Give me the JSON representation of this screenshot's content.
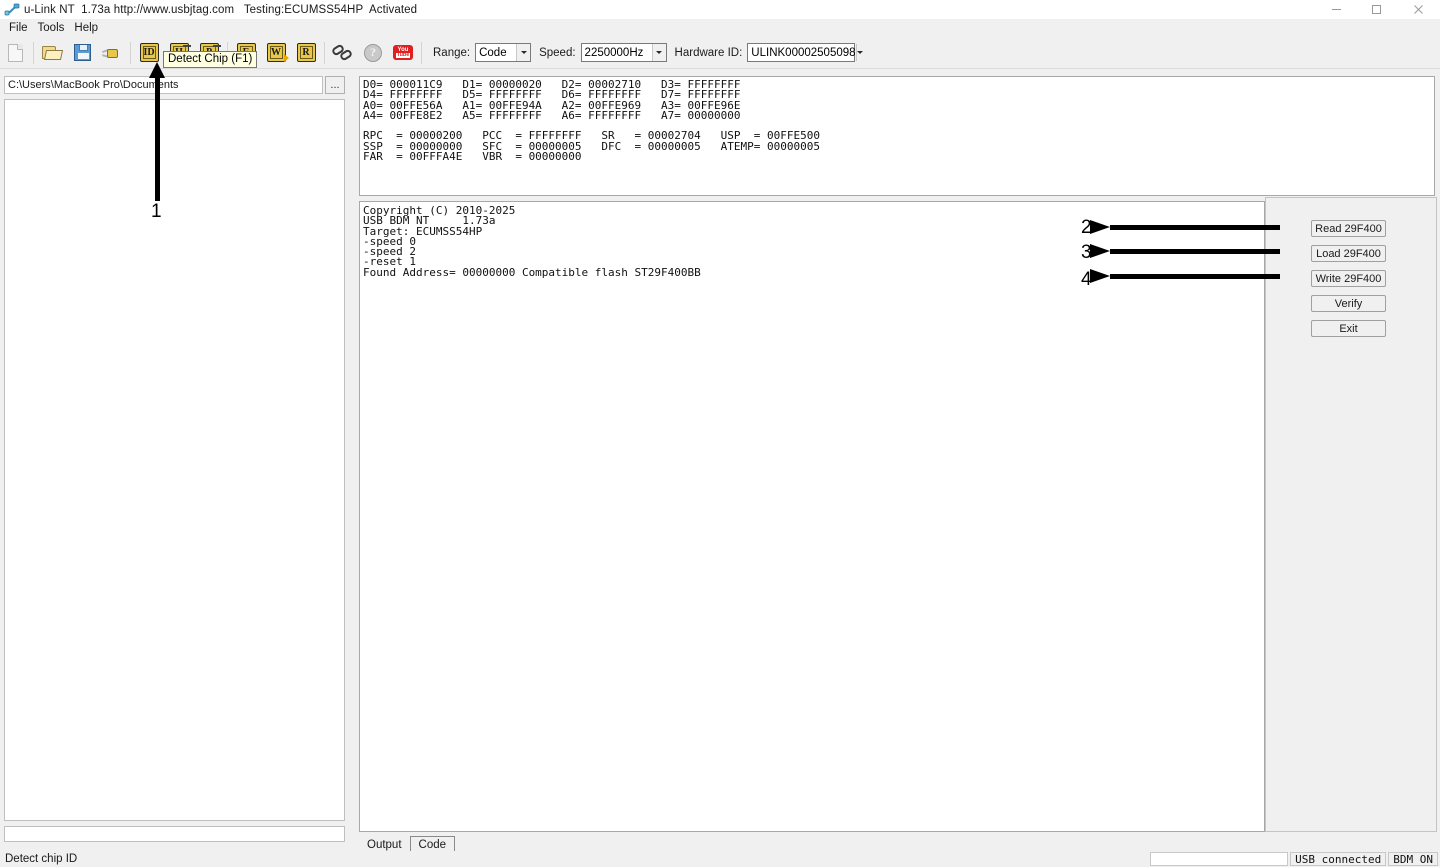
{
  "window": {
    "title": "u-Link NT  1.73a http://www.usbjtag.com   Testing:ECUMSS54HP  Activated",
    "app_icon": "cable-icon",
    "minimize_label": "–",
    "maximize_label": "□",
    "close_label": "✕"
  },
  "menubar": {
    "items": [
      {
        "label": "File"
      },
      {
        "label": "Tools"
      },
      {
        "label": "Help"
      }
    ]
  },
  "toolbar": {
    "buttons": [
      {
        "icon": "new-file-icon",
        "letter": ""
      },
      {
        "icon": "open-folder-icon",
        "letter": ""
      },
      {
        "icon": "save-floppy-icon",
        "letter": ""
      },
      {
        "icon": "chip-cable-icon",
        "letter": ""
      },
      {
        "icon": "detect-chip-id-icon",
        "letter": "ID"
      },
      {
        "icon": "read-header-icon",
        "letter": "H"
      },
      {
        "icon": "program-icon",
        "letter": "P"
      },
      {
        "icon": "erase-chip-icon",
        "letter": "E"
      },
      {
        "icon": "write-chip-icon",
        "letter": "W"
      },
      {
        "icon": "read-chip-icon",
        "letter": "R"
      },
      {
        "icon": "link-chain-icon",
        "letter": ""
      },
      {
        "icon": "help-icon",
        "letter": "?"
      },
      {
        "icon": "youtube-icon",
        "letter": ""
      }
    ],
    "range": {
      "label": "Range:",
      "value": "Code"
    },
    "speed": {
      "label": "Speed:",
      "value": "2250000Hz"
    },
    "hardware_id": {
      "label": "Hardware ID:",
      "value": "ULINK00002505098"
    }
  },
  "tooltip": {
    "text": "Detect Chip (F1)"
  },
  "left_panel": {
    "path_value": "C:\\Users\\MacBook Pro\\Documents",
    "path_placeholder": "",
    "browse_label": "...",
    "file_list_items": [],
    "bottom_field_value": ""
  },
  "registers": {
    "text": "D0= 000011C9   D1= 00000020   D2= 00002710   D3= FFFFFFFF\nD4= FFFFFFFF   D5= FFFFFFFF   D6= FFFFFFFF   D7= FFFFFFFF\nA0= 00FFE56A   A1= 00FFE94A   A2= 00FFE969   A3= 00FFE96E\nA4= 00FFE8E2   A5= FFFFFFFF   A6= FFFFFFFF   A7= 00000000\n\nRPC  = 00000200   PCC  = FFFFFFFF   SR   = 00002704   USP  = 00FFE500\nSSP  = 00000000   SFC  = 00000005   DFC  = 00000005   ATEMP= 00000005\nFAR  = 00FFFA4E   VBR  = 00000000",
    "rows": [
      {
        "D0": "000011C9",
        "D1": "00000020",
        "D2": "00002710",
        "D3": "FFFFFFFF"
      },
      {
        "D4": "FFFFFFFF",
        "D5": "FFFFFFFF",
        "D6": "FFFFFFFF",
        "D7": "FFFFFFFF"
      },
      {
        "A0": "00FFE56A",
        "A1": "00FFE94A",
        "A2": "00FFE969",
        "A3": "00FFE96E"
      },
      {
        "A4": "00FFE8E2",
        "A5": "FFFFFFFF",
        "A6": "FFFFFFFF",
        "A7": "00000000"
      }
    ],
    "special": {
      "RPC": "00000200",
      "PCC": "FFFFFFFF",
      "SR": "00002704",
      "USP": "00FFE500",
      "SSP": "00000000",
      "SFC": "00000005",
      "DFC": "00000005",
      "ATEMP": "00000005",
      "FAR": "00FFFA4E",
      "VBR": "00000000"
    }
  },
  "log": {
    "text": "Copyright (C) 2010-2025\nUSB BDM NT     1.73a\nTarget: ECUMSS54HP\n-speed 0\n-speed 2\n-reset 1\nFound Address= 00000000 Compatible flash ST29F400BB",
    "lines": [
      "Copyright (C) 2010-2025",
      "USB BDM NT     1.73a",
      "Target: ECUMSS54HP",
      "-speed 0",
      "-speed 2",
      "-reset 1",
      "Found Address= 00000000 Compatible flash ST29F400BB"
    ]
  },
  "side_buttons": [
    {
      "label": "Read 29F400"
    },
    {
      "label": "Load 29F400"
    },
    {
      "label": "Write 29F400"
    },
    {
      "label": "Verify"
    },
    {
      "label": "Exit"
    }
  ],
  "tabs": [
    {
      "label": "Output",
      "active": false
    },
    {
      "label": "Code",
      "active": true
    }
  ],
  "statusbar": {
    "message": "Detect chip ID",
    "blank_field": "",
    "usb_status": "USB connected",
    "bdm_status": "BDM ON"
  },
  "annotations": [
    {
      "number": "1",
      "direction": "up",
      "target": "detect-chip-toolbar-button"
    },
    {
      "number": "2",
      "direction": "right",
      "target": "read-29f400-button"
    },
    {
      "number": "3",
      "direction": "right",
      "target": "load-29f400-button"
    },
    {
      "number": "4",
      "direction": "right",
      "target": "write-29f400-button"
    }
  ],
  "colors": {
    "window_bg": "#f0f0f0",
    "field_bg": "#ffffff",
    "chip_icon": "#e8c84a",
    "youtube_red": "#e02020",
    "annotation": "#000000",
    "tooltip_bg": "#ffffe1"
  }
}
